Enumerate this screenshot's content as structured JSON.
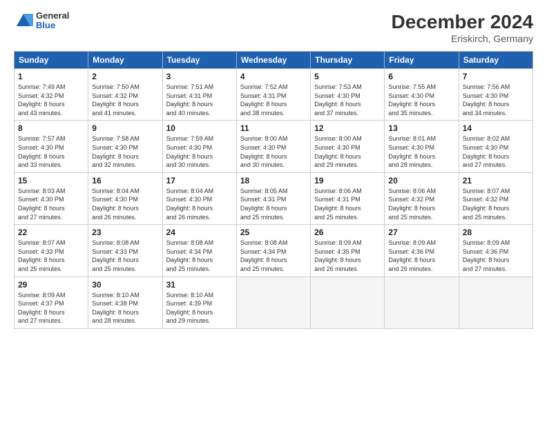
{
  "header": {
    "logo_general": "General",
    "logo_blue": "Blue",
    "month_title": "December 2024",
    "location": "Eriskirch, Germany"
  },
  "columns": [
    "Sunday",
    "Monday",
    "Tuesday",
    "Wednesday",
    "Thursday",
    "Friday",
    "Saturday"
  ],
  "weeks": [
    [
      {
        "day": "1",
        "info": "Sunrise: 7:49 AM\nSunset: 4:32 PM\nDaylight: 8 hours\nand 43 minutes."
      },
      {
        "day": "2",
        "info": "Sunrise: 7:50 AM\nSunset: 4:32 PM\nDaylight: 8 hours\nand 41 minutes."
      },
      {
        "day": "3",
        "info": "Sunrise: 7:51 AM\nSunset: 4:31 PM\nDaylight: 8 hours\nand 40 minutes."
      },
      {
        "day": "4",
        "info": "Sunrise: 7:52 AM\nSunset: 4:31 PM\nDaylight: 8 hours\nand 38 minutes."
      },
      {
        "day": "5",
        "info": "Sunrise: 7:53 AM\nSunset: 4:30 PM\nDaylight: 8 hours\nand 37 minutes."
      },
      {
        "day": "6",
        "info": "Sunrise: 7:55 AM\nSunset: 4:30 PM\nDaylight: 8 hours\nand 35 minutes."
      },
      {
        "day": "7",
        "info": "Sunrise: 7:56 AM\nSunset: 4:30 PM\nDaylight: 8 hours\nand 34 minutes."
      }
    ],
    [
      {
        "day": "8",
        "info": "Sunrise: 7:57 AM\nSunset: 4:30 PM\nDaylight: 8 hours\nand 33 minutes."
      },
      {
        "day": "9",
        "info": "Sunrise: 7:58 AM\nSunset: 4:30 PM\nDaylight: 8 hours\nand 32 minutes."
      },
      {
        "day": "10",
        "info": "Sunrise: 7:59 AM\nSunset: 4:30 PM\nDaylight: 8 hours\nand 30 minutes."
      },
      {
        "day": "11",
        "info": "Sunrise: 8:00 AM\nSunset: 4:30 PM\nDaylight: 8 hours\nand 30 minutes."
      },
      {
        "day": "12",
        "info": "Sunrise: 8:00 AM\nSunset: 4:30 PM\nDaylight: 8 hours\nand 29 minutes."
      },
      {
        "day": "13",
        "info": "Sunrise: 8:01 AM\nSunset: 4:30 PM\nDaylight: 8 hours\nand 28 minutes."
      },
      {
        "day": "14",
        "info": "Sunrise: 8:02 AM\nSunset: 4:30 PM\nDaylight: 8 hours\nand 27 minutes."
      }
    ],
    [
      {
        "day": "15",
        "info": "Sunrise: 8:03 AM\nSunset: 4:30 PM\nDaylight: 8 hours\nand 27 minutes."
      },
      {
        "day": "16",
        "info": "Sunrise: 8:04 AM\nSunset: 4:30 PM\nDaylight: 8 hours\nand 26 minutes."
      },
      {
        "day": "17",
        "info": "Sunrise: 8:04 AM\nSunset: 4:30 PM\nDaylight: 8 hours\nand 26 minutes."
      },
      {
        "day": "18",
        "info": "Sunrise: 8:05 AM\nSunset: 4:31 PM\nDaylight: 8 hours\nand 25 minutes."
      },
      {
        "day": "19",
        "info": "Sunrise: 8:06 AM\nSunset: 4:31 PM\nDaylight: 8 hours\nand 25 minutes."
      },
      {
        "day": "20",
        "info": "Sunrise: 8:06 AM\nSunset: 4:32 PM\nDaylight: 8 hours\nand 25 minutes."
      },
      {
        "day": "21",
        "info": "Sunrise: 8:07 AM\nSunset: 4:32 PM\nDaylight: 8 hours\nand 25 minutes."
      }
    ],
    [
      {
        "day": "22",
        "info": "Sunrise: 8:07 AM\nSunset: 4:33 PM\nDaylight: 8 hours\nand 25 minutes."
      },
      {
        "day": "23",
        "info": "Sunrise: 8:08 AM\nSunset: 4:33 PM\nDaylight: 8 hours\nand 25 minutes."
      },
      {
        "day": "24",
        "info": "Sunrise: 8:08 AM\nSunset: 4:34 PM\nDaylight: 8 hours\nand 25 minutes."
      },
      {
        "day": "25",
        "info": "Sunrise: 8:08 AM\nSunset: 4:34 PM\nDaylight: 8 hours\nand 25 minutes."
      },
      {
        "day": "26",
        "info": "Sunrise: 8:09 AM\nSunset: 4:35 PM\nDaylight: 8 hours\nand 26 minutes."
      },
      {
        "day": "27",
        "info": "Sunrise: 8:09 AM\nSunset: 4:36 PM\nDaylight: 8 hours\nand 26 minutes."
      },
      {
        "day": "28",
        "info": "Sunrise: 8:09 AM\nSunset: 4:36 PM\nDaylight: 8 hours\nand 27 minutes."
      }
    ],
    [
      {
        "day": "29",
        "info": "Sunrise: 8:09 AM\nSunset: 4:37 PM\nDaylight: 8 hours\nand 27 minutes."
      },
      {
        "day": "30",
        "info": "Sunrise: 8:10 AM\nSunset: 4:38 PM\nDaylight: 8 hours\nand 28 minutes."
      },
      {
        "day": "31",
        "info": "Sunrise: 8:10 AM\nSunset: 4:39 PM\nDaylight: 8 hours\nand 29 minutes."
      },
      {
        "day": "",
        "info": ""
      },
      {
        "day": "",
        "info": ""
      },
      {
        "day": "",
        "info": ""
      },
      {
        "day": "",
        "info": ""
      }
    ]
  ]
}
